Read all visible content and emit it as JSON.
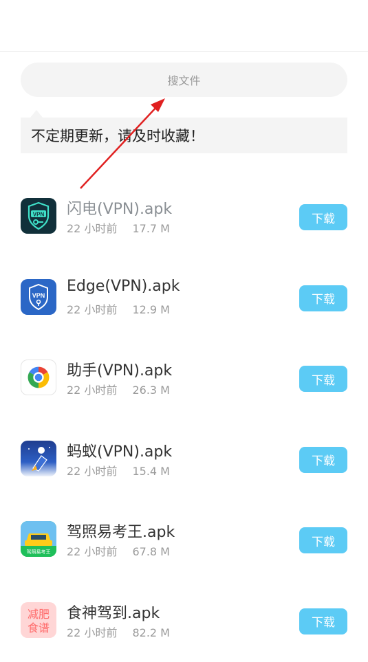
{
  "search": {
    "placeholder": "搜文件"
  },
  "notice": {
    "text": "不定期更新，请及时收藏！"
  },
  "colors": {
    "accent": "#5ccbf5",
    "arrow": "#e02020",
    "surface": "#f4f4f4"
  },
  "files": [
    {
      "name": "闪电(VPN).apk",
      "time": "22 小时前",
      "size": "17.7 M",
      "button": "下载",
      "icon": "vpn-shield-key-icon"
    },
    {
      "name": "Edge(VPN).apk",
      "time": "22 小时前",
      "size": "12.9 M",
      "button": "下载",
      "icon": "vpn-shield-lock-icon"
    },
    {
      "name": "助手(VPN).apk",
      "time": "22 小时前",
      "size": "26.3 M",
      "button": "下载",
      "icon": "color-ring-icon"
    },
    {
      "name": "蚂蚁(VPN).apk",
      "time": "22 小时前",
      "size": "15.4 M",
      "button": "下载",
      "icon": "rocket-astronaut-icon"
    },
    {
      "name": "驾照易考王.apk",
      "time": "22 小时前",
      "size": "67.8 M",
      "button": "下载",
      "icon": "taxi-car-icon",
      "icon_label": "驾照易考王"
    },
    {
      "name": "食神驾到.apk",
      "time": "22 小时前",
      "size": "82.2 M",
      "button": "下载",
      "icon": "diet-recipe-icon",
      "icon_label": "减肥食谱"
    }
  ]
}
